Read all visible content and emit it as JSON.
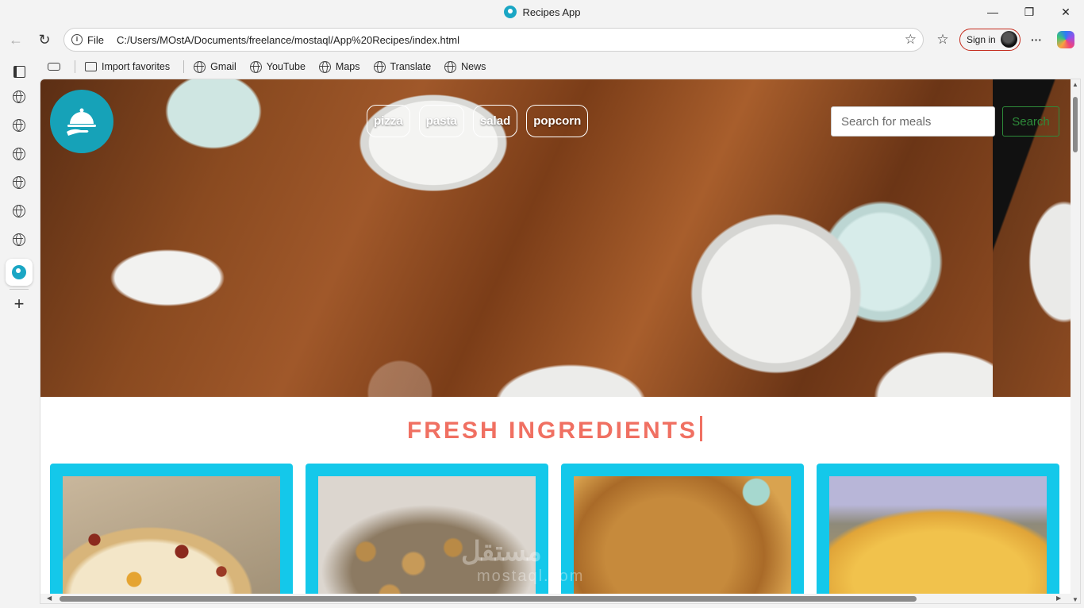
{
  "window": {
    "title": "Recipes App",
    "minimize": "—",
    "maximize": "❐",
    "close": "✕"
  },
  "address_bar": {
    "back": "←",
    "reload": "↻",
    "scheme": "File",
    "url": "C:/Users/MOstA/Documents/freelance/mostaql/App%20Recipes/index.html",
    "favorite": "☆",
    "collections": "☆",
    "signin": "Sign in",
    "more": "···"
  },
  "favorites_bar": {
    "items": [
      {
        "label": "Import favorites",
        "icon": "import-icon"
      },
      {
        "label": "Gmail",
        "icon": "globe-icon"
      },
      {
        "label": "YouTube",
        "icon": "globe-icon"
      },
      {
        "label": "Maps",
        "icon": "globe-icon"
      },
      {
        "label": "Translate",
        "icon": "globe-icon"
      },
      {
        "label": "News",
        "icon": "globe-icon"
      }
    ]
  },
  "sidebar": {
    "add": "+"
  },
  "page": {
    "categories": [
      "pizza",
      "pasta",
      "salad",
      "popcorn"
    ],
    "search": {
      "placeholder": "Search for meals",
      "button": "Search"
    },
    "section_title": "FRESH INGREDIENTS",
    "watermark": "مستقل",
    "watermark_sub": "mostaql.com",
    "cards": [
      {
        "image": "pizza-dish"
      },
      {
        "image": "pasta-dish"
      },
      {
        "image": "fried-dish"
      },
      {
        "image": "baked-dish"
      }
    ]
  },
  "colors": {
    "accent": "#f07062",
    "card_bg": "#14c8ea",
    "logo_bg": "#16a2b8",
    "search_button": "#2e8b3a"
  }
}
